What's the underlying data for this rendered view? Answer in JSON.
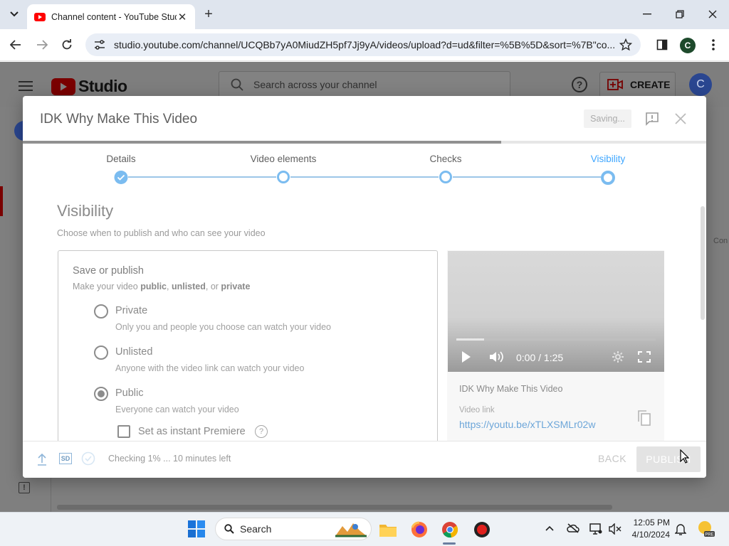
{
  "browser": {
    "tab_title": "Channel content - YouTube Studio",
    "url": "studio.youtube.com/channel/UCQBb7yA0MiudZH5pf7Jj9yA/videos/upload?d=ud&filter=%5B%5D&sort=%7B\"co...",
    "profile_initial": "C"
  },
  "studio": {
    "logo_text": "Studio",
    "search_placeholder": "Search across your channel",
    "create_label": "CREATE",
    "avatar_initial": "C",
    "right_fragment": "Con"
  },
  "dialog": {
    "title": "IDK Why Make This Video",
    "saving_label": "Saving...",
    "progress": 0.7,
    "steps": [
      {
        "label": "Details",
        "state": "done"
      },
      {
        "label": "Video elements",
        "state": "pending"
      },
      {
        "label": "Checks",
        "state": "pending"
      },
      {
        "label": "Visibility",
        "state": "current"
      }
    ],
    "heading": "Visibility",
    "subheading": "Choose when to publish and who can see your video",
    "save_publish": {
      "title": "Save or publish",
      "sub_prefix": "Make your video ",
      "sub_public": "public",
      "sub_sep1": ", ",
      "sub_unlisted": "unlisted",
      "sub_sep2": ", or ",
      "sub_private": "private",
      "options": [
        {
          "label": "Private",
          "description": "Only you and people you choose can watch your video",
          "selected": false
        },
        {
          "label": "Unlisted",
          "description": "Anyone with the video link can watch your video",
          "selected": false
        },
        {
          "label": "Public",
          "description": "Everyone can watch your video",
          "selected": true
        }
      ],
      "premiere_label": "Set as instant Premiere",
      "premiere_help": "?"
    },
    "preview": {
      "time": "0:00 / 1:25",
      "played_fraction": 0.14,
      "video_title": "IDK Why Make This Video",
      "link_label": "Video link",
      "link": "https://youtu.be/xTLXSMLr02w"
    },
    "footer": {
      "sd_badge": "SD",
      "status": "Checking 1% ... 10 minutes left",
      "back_label": "BACK",
      "publish_label": "PUBLISH"
    }
  },
  "taskbar": {
    "search_label": "Search",
    "time": "12:05 PM",
    "date": "4/10/2024"
  },
  "colors": {
    "accent_blue": "#3ea6ff",
    "youtube_red": "#ff0000"
  }
}
